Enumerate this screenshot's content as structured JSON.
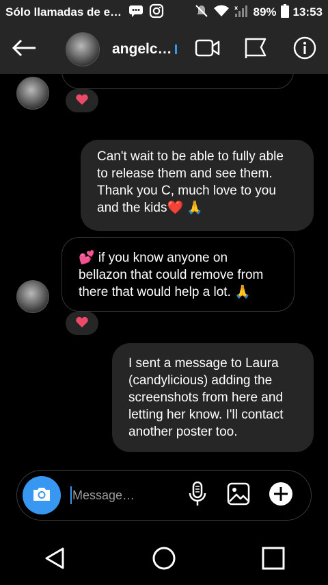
{
  "status_bar": {
    "carrier": "Sólo llamadas de e…",
    "battery": "89%",
    "time": "13:53"
  },
  "header": {
    "username": "angelc…",
    "icons": [
      "back-arrow-icon",
      "video-call-icon",
      "flag-icon",
      "info-icon"
    ]
  },
  "messages": [
    {
      "sender": "them",
      "text": "",
      "reaction": "❤️",
      "partial": true
    },
    {
      "sender": "me",
      "lines": [
        "Can't wait to be able to fully able",
        "to release them and see them.",
        "Thank you C, much love to you",
        "and the kids❤️ 🙏"
      ]
    },
    {
      "sender": "them",
      "lines": [
        "💕 if you know anyone on",
        "bellazon that could remove from",
        "there that would help a lot. 🙏"
      ],
      "reaction": "❤️"
    },
    {
      "sender": "me",
      "lines": [
        "I sent a message to Laura",
        "(candylicious) adding the",
        "screenshots from here and",
        "letting her know. I'll contact",
        "another poster too."
      ]
    }
  ],
  "composer": {
    "placeholder": "Message…"
  }
}
